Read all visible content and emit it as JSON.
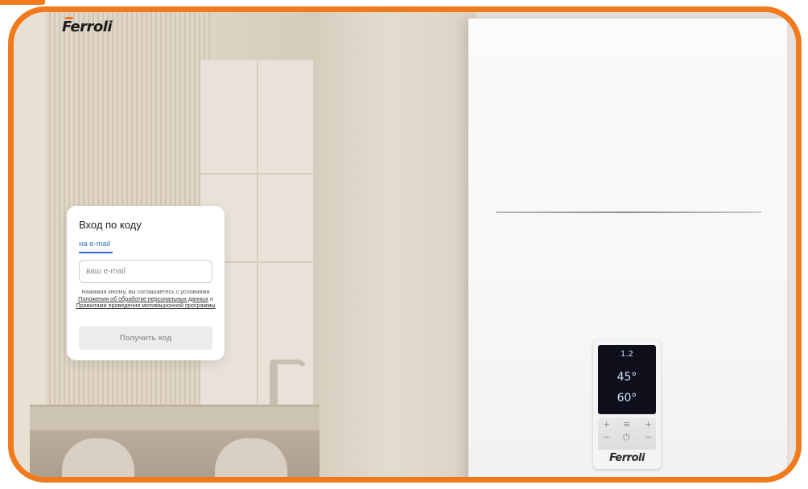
{
  "brand": {
    "logo_text": "Ferroli",
    "accent_color": "#f07a1c"
  },
  "login": {
    "title": "Вход по коду",
    "tab_label": "на e-mail",
    "email_placeholder": "ваш e-mail",
    "email_value": "",
    "terms": {
      "prefix": "Нажимая кнопку, вы соглашаетесь с условиями",
      "link1": "Положения об обработке персональных данных",
      "middle": "и",
      "link2": "Правилами проведения мотивационной программы"
    },
    "submit_label": "Получить код",
    "link_color": "#2f6fd1"
  },
  "boiler_panel": {
    "row1": "1.2",
    "row2": "45°",
    "row3": "60°",
    "logo_text": "Ferroli"
  }
}
